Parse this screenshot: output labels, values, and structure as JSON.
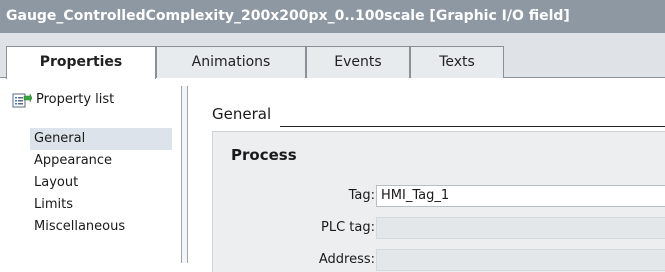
{
  "window": {
    "title": "Gauge_ControlledComplexity_200x200px_0..100scale [Graphic I/O field]"
  },
  "tabs": [
    {
      "label": "Properties",
      "active": true
    },
    {
      "label": "Animations",
      "active": false
    },
    {
      "label": "Events",
      "active": false
    },
    {
      "label": "Texts",
      "active": false
    }
  ],
  "sidebar": {
    "header": {
      "label": "Property list",
      "icon": "property-list-icon"
    },
    "items": [
      {
        "label": "General",
        "selected": true
      },
      {
        "label": "Appearance",
        "selected": false
      },
      {
        "label": "Layout",
        "selected": false
      },
      {
        "label": "Limits",
        "selected": false
      },
      {
        "label": "Miscellaneous",
        "selected": false
      }
    ]
  },
  "main": {
    "section_title": "General",
    "group": {
      "title": "Process",
      "fields": [
        {
          "label": "Tag:",
          "value": "HMI_Tag_1",
          "enabled": true
        },
        {
          "label": "PLC tag:",
          "value": "",
          "enabled": false
        },
        {
          "label": "Address:",
          "value": "",
          "enabled": false
        }
      ]
    }
  },
  "colors": {
    "title_bar": "#8d98a2",
    "tab_strip": "#dfe3e8",
    "selected_item": "#dce3ea",
    "panel": "#eceef0"
  }
}
